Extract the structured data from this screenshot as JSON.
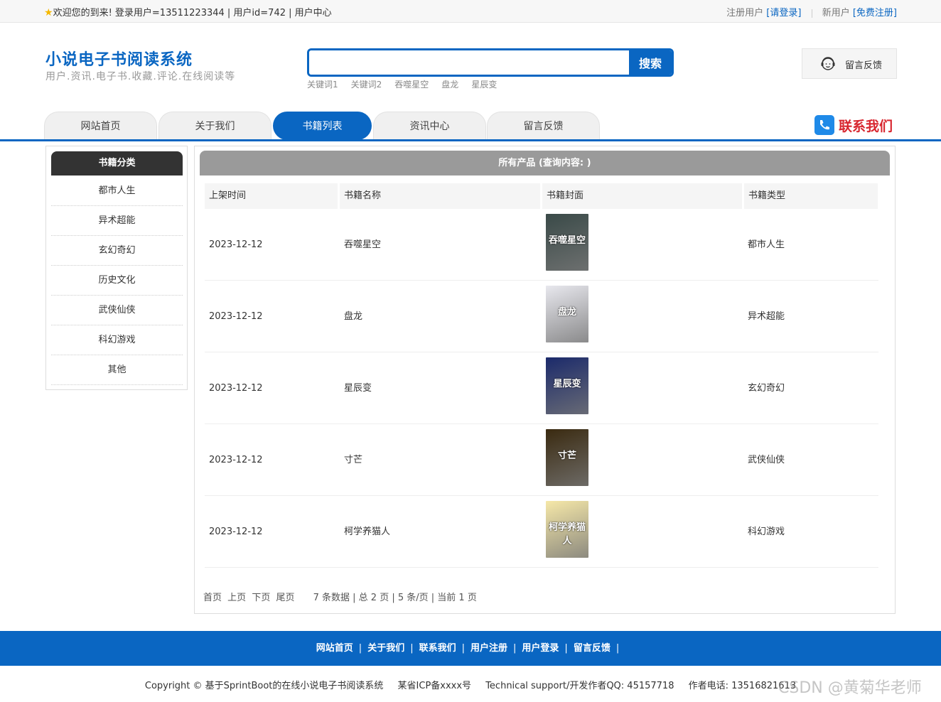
{
  "topbar": {
    "welcome": "欢迎您的到来!  登录用户=13511223344 | 用户id=742 | 用户中心",
    "register_user_label": "注册用户",
    "login_link": "[请登录]",
    "new_user_label": "新用户",
    "free_register_link": "[免费注册]"
  },
  "header": {
    "title": "小说电子书阅读系统",
    "subtitle": "用户.资讯.电子书.收藏.评论.在线阅读等",
    "search": {
      "value": "",
      "placeholder": "",
      "button": "搜索"
    },
    "keywords": [
      "关键词1",
      "关键词2",
      "吞噬星空",
      "盘龙",
      "星辰变"
    ],
    "feedback": "留言反馈"
  },
  "nav": {
    "tabs": [
      "网站首页",
      "关于我们",
      "书籍列表",
      "资讯中心",
      "留言反馈"
    ],
    "active_index": 2,
    "contact": "联系我们"
  },
  "sidebar": {
    "title": "书籍分类",
    "categories": [
      "都市人生",
      "异术超能",
      "玄幻奇幻",
      "历史文化",
      "武侠仙侠",
      "科幻游戏",
      "其他"
    ]
  },
  "main": {
    "title": "所有产品 (查询内容: )",
    "columns": [
      "上架时间",
      "书籍名称",
      "书籍封面",
      "书籍类型"
    ],
    "rows": [
      {
        "date": "2023-12-12",
        "name": "吞噬星空",
        "type": "都市人生",
        "cover_color": "#3a4a48"
      },
      {
        "date": "2023-12-12",
        "name": "盘龙",
        "type": "异术超能",
        "cover_color": "#e8e8ee"
      },
      {
        "date": "2023-12-12",
        "name": "星辰变",
        "type": "玄幻奇幻",
        "cover_color": "#1b2a6b"
      },
      {
        "date": "2023-12-12",
        "name": "寸芒",
        "type": "武侠仙侠",
        "cover_color": "#3a2a10"
      },
      {
        "date": "2023-12-12",
        "name": "柯学养猫人",
        "type": "科幻游戏",
        "cover_color": "#f6e8a8"
      }
    ],
    "pager": {
      "first": "首页",
      "prev": "上页",
      "next": "下页",
      "last": "尾页",
      "summary": "7 条数据 | 总 2 页 | 5 条/页 | 当前 1 页"
    }
  },
  "footer": {
    "links": [
      "网站首页",
      "关于我们",
      "联系我们",
      "用户注册",
      "用户登录",
      "留言反馈"
    ],
    "copyright": "Copyright © 基于SprintBoot的在线小说电子书阅读系统",
    "icp": "某省ICP备xxxx号",
    "support": "Technical support/开发作者QQ: 45157718",
    "phone": "作者电话: 13516821613",
    "watermark": "CSDN @黄菊华老师"
  },
  "colors": {
    "primary": "#0a66c2",
    "contact_red": "#d8262f",
    "sidebar_head": "#333333",
    "main_head": "#9a9a9a"
  }
}
